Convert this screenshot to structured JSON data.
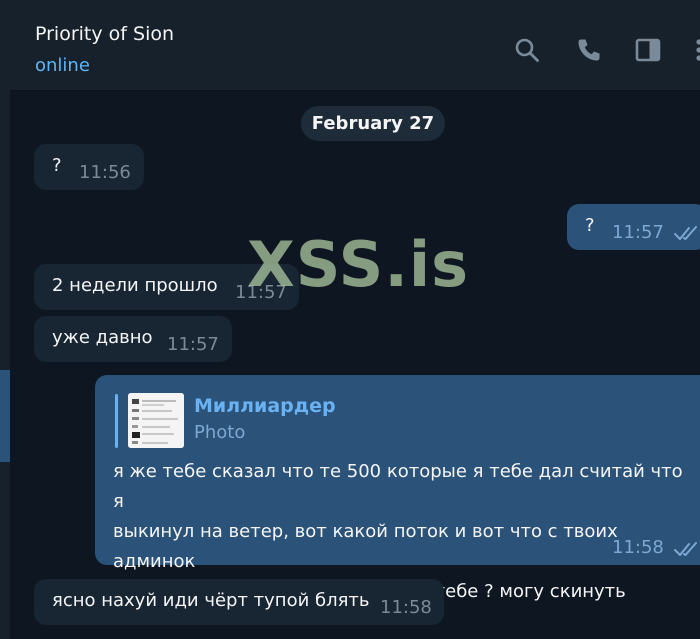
{
  "header": {
    "title": "Priority of Sion",
    "status": "online",
    "icons": [
      "search-icon",
      "phone-icon",
      "sidebar-toggle-icon",
      "more-icon"
    ]
  },
  "date_separator": "February 27",
  "messages": [
    {
      "direction": "in",
      "text": "?",
      "time": "11:56"
    },
    {
      "direction": "out",
      "text": "?",
      "time": "11:57",
      "read": true
    },
    {
      "direction": "in",
      "text": "2 недели прошло",
      "time": "11:57"
    },
    {
      "direction": "in",
      "text": "уже давно",
      "time": "11:57"
    },
    {
      "direction": "out",
      "reply": {
        "author": "Миллиардер",
        "kind": "Photo"
      },
      "lines": [
        "я же тебе сказал что те 500 которые я тебе дал считай что я",
        "выкинул на ветер, вот какой поток и вот что с твоих админок",
        "падает, логи бангладеша нужны тебе ? могу скинуть"
      ],
      "time": "11:58",
      "read": true
    },
    {
      "direction": "in",
      "text": "ясно нахуй иди чёрт тупой блять",
      "time": "11:58"
    }
  ],
  "watermark": "XSS.is",
  "colors": {
    "background": "#0e1621",
    "incoming": "#182533",
    "outgoing": "#2b5278",
    "accent": "#5eb5f7"
  }
}
